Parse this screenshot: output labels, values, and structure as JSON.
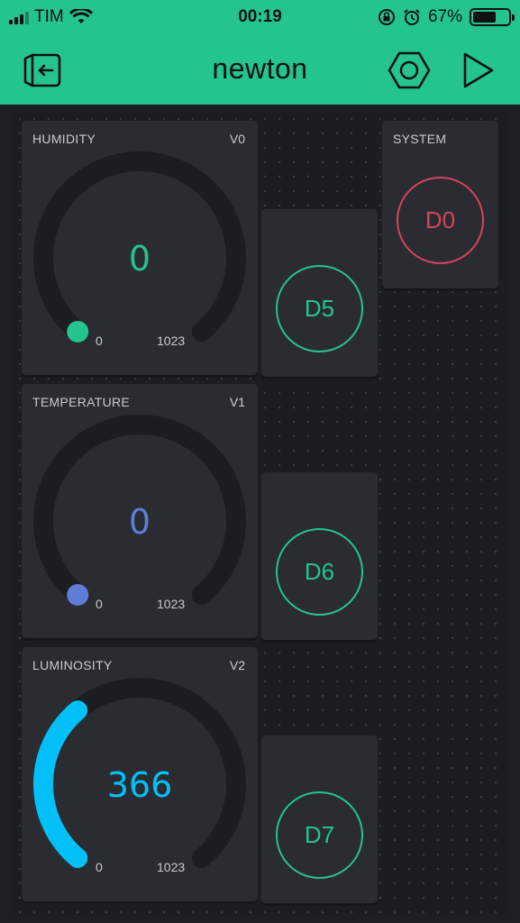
{
  "status": {
    "carrier": "TIM",
    "time": "00:19",
    "battery_percent": "67%",
    "battery_level": 0.67
  },
  "header": {
    "title": "newton"
  },
  "gauges": [
    {
      "label": "HUMIDITY",
      "pin": "V0",
      "value": "0",
      "min": "0",
      "max": "1023",
      "color": "#23c48e",
      "fraction": 0
    },
    {
      "label": "TEMPERATURE",
      "pin": "V1",
      "value": "0",
      "min": "0",
      "max": "1023",
      "color": "#5f7cd8",
      "fraction": 0
    },
    {
      "label": "LUMINOSITY",
      "pin": "V2",
      "value": "366",
      "min": "0",
      "max": "1023",
      "color": "#04c0f8",
      "fraction": 0.357
    }
  ],
  "buttons": {
    "system": {
      "label": "SYSTEM",
      "pin": "D0",
      "color": "#d3435c"
    },
    "d5": {
      "pin": "D5",
      "color": "#23c48e"
    },
    "d6": {
      "pin": "D6",
      "color": "#23c48e"
    },
    "d7": {
      "pin": "D7",
      "color": "#23c48e"
    }
  }
}
